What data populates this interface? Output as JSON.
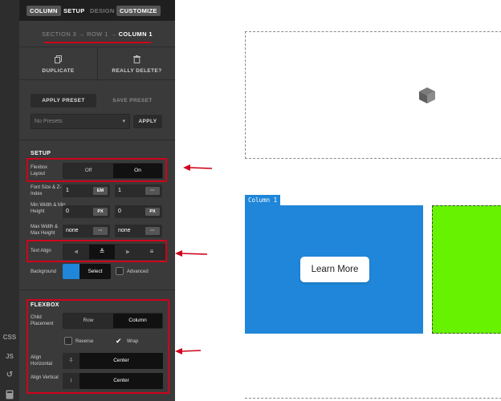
{
  "toolbar": {
    "tabs": [
      {
        "label": "COLUMN"
      },
      {
        "label": "SETUP"
      },
      {
        "label": "DESIGN"
      },
      {
        "label": "CUSTOMIZE"
      }
    ]
  },
  "breadcrumb": {
    "section": "SECTION 3",
    "row": "ROW 1",
    "column": "COLUMN 1",
    "separator": "→"
  },
  "actions": {
    "duplicate": "DUPLICATE",
    "delete": "REALLY DELETE?"
  },
  "presets": {
    "apply_preset": "APPLY PRESET",
    "save_preset": "SAVE PRESET",
    "select_value": "No Presets",
    "apply": "APPLY"
  },
  "setup": {
    "title": "SETUP",
    "flexbox_layout": {
      "label": "Flexbox Layout",
      "options": [
        "Off",
        "On"
      ],
      "selected": "On"
    },
    "font_size": {
      "label": "Font Size & Z-Index",
      "value1": "1",
      "unit1": "EM",
      "value2": "1",
      "unit2": "···"
    },
    "min_width": {
      "label": "Min Width & Min Height",
      "value1": "0",
      "unit1": "PX",
      "value2": "0",
      "unit2": "PX"
    },
    "max_width": {
      "label": "Max Width & Max Height",
      "value1": "none",
      "unit1": "···",
      "value2": "none",
      "unit2": "···"
    },
    "text_align": {
      "label": "Text Align",
      "selected": "center"
    },
    "background": {
      "label": "Background",
      "select": "Select",
      "advanced": "Advanced",
      "color": "#1f86d9"
    }
  },
  "flexbox": {
    "title": "FLEXBOX",
    "child_placement": {
      "label": "Child Placement",
      "options": [
        "Row",
        "Column"
      ],
      "selected": "Column"
    },
    "reverse": {
      "label": "Reverse",
      "checked": false
    },
    "wrap": {
      "label": "Wrap",
      "checked": true
    },
    "align_horizontal": {
      "label": "Align Horizontal",
      "value": "Center"
    },
    "align_vertical": {
      "label": "Align Vertical",
      "value": "Center"
    }
  },
  "sidebar_strip": {
    "css": "CSS",
    "js": "JS"
  },
  "canvas": {
    "column_tag": "Column 1",
    "button_label": "Learn More",
    "column_color": "#1f86d9",
    "neighbor_color": "#66f200"
  },
  "annotations": {
    "color": "#d0021b"
  }
}
